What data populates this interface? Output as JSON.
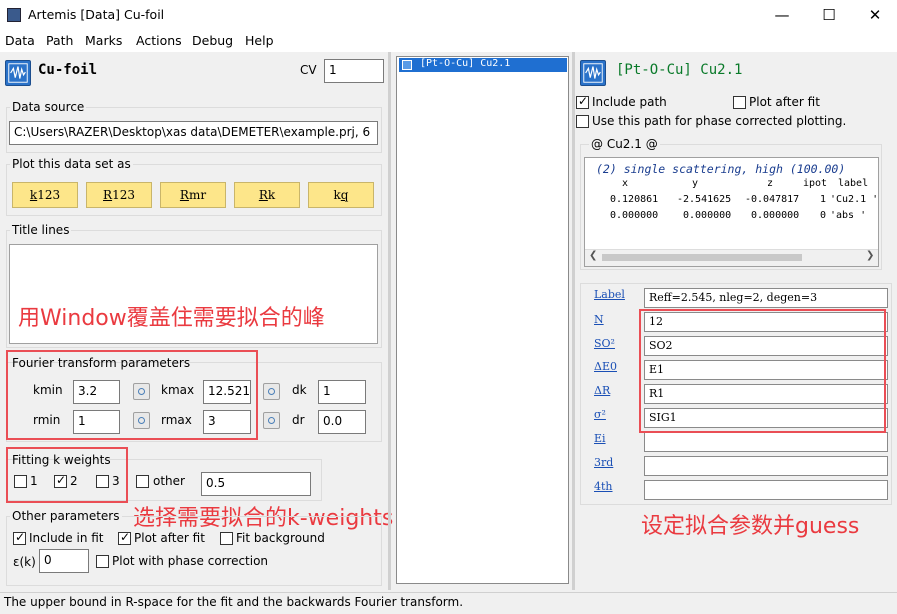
{
  "window": {
    "title": "Artemis [Data] Cu-foil",
    "minimize": "—",
    "maximize": "☐",
    "close": "✕"
  },
  "menu": [
    "Data",
    "Path",
    "Marks",
    "Actions",
    "Debug",
    "Help"
  ],
  "left": {
    "data_name": "Cu-foil",
    "cv_label": "CV",
    "cv_value": "1",
    "data_source_label": "Data source",
    "data_source_path": "C:\\Users\\RAZER\\Desktop\\xas data\\DEMETER\\example.prj, 6",
    "plot_label": "Plot this data set as",
    "plot_buttons": [
      {
        "prefix": "",
        "ul": "k",
        "rest": "123"
      },
      {
        "prefix": "",
        "ul": "R",
        "rest": "123"
      },
      {
        "prefix": "",
        "ul": "R",
        "rest": "mr"
      },
      {
        "prefix": "",
        "ul": "R",
        "rest": "k"
      },
      {
        "prefix": "k",
        "ul": "q",
        "rest": ""
      }
    ],
    "title_lines_label": "Title lines",
    "fourier_label": "Fourier transform parameters",
    "kmin_label": "kmin",
    "kmin_value": "3.2",
    "kmax_label": "kmax",
    "kmax_value": "12.521",
    "dk_label": "dk",
    "dk_value": "1",
    "rmin_label": "rmin",
    "rmin_value": "1",
    "rmax_label": "rmax",
    "rmax_value": "3",
    "dr_label": "dr",
    "dr_value": "0.0",
    "kweights_label": "Fitting k weights",
    "kw1": "1",
    "kw2": "2",
    "kw3": "3",
    "other_label": "other",
    "other_value": "0.5",
    "other_params_label": "Other parameters",
    "include_fit": "Include in fit",
    "plot_after_fit": "Plot after fit",
    "fit_background": "Fit background",
    "epsilon_label": "ε(k)",
    "epsilon_value": "0",
    "plot_phase": "Plot with phase correction"
  },
  "path_list": {
    "items": [
      "[Pt-O-Cu] Cu2.1"
    ]
  },
  "right": {
    "path_title": "[Pt-O-Cu] Cu2.1",
    "include_path": "Include path",
    "plot_after_fit": "Plot after fit",
    "use_phase": "Use this path for phase corrected plotting.",
    "feff_header": "@ Cu2.1  @",
    "feff_scattering": "(2) single scattering, high (100.00)",
    "feff_cols": {
      "x": "x",
      "y": "y",
      "z": "z",
      "ipot": "ipot",
      "label": "label"
    },
    "feff_rows": [
      {
        "x": "0.120861",
        "y": "-2.541625",
        "z": "-0.047817",
        "ipot": "1",
        "label": "'Cu2.1 '"
      },
      {
        "x": "0.000000",
        "y": "0.000000",
        "z": "0.000000",
        "ipot": "0",
        "label": "'abs '"
      }
    ],
    "params": [
      {
        "label": "Label",
        "value": "Reff=2.545, nleg=2, degen=3"
      },
      {
        "label": "N",
        "value": "12"
      },
      {
        "label": "SO²",
        "value": "SO2"
      },
      {
        "label": "ΔE0",
        "value": "E1"
      },
      {
        "label": "ΔR",
        "value": "R1"
      },
      {
        "label": "σ²",
        "value": "SIG1"
      },
      {
        "label": "Ei",
        "value": ""
      },
      {
        "label": "3rd",
        "value": ""
      },
      {
        "label": "4th",
        "value": ""
      }
    ]
  },
  "annotations": {
    "window_cover": "用Window覆盖住需要拟合的峰",
    "select_kweights": "选择需要拟合的k-weights",
    "set_params": "设定拟合参数并guess"
  },
  "status": "The upper bound in R-space for the fit and the backwards Fourier transform.",
  "colors": {
    "annotation_red": "#ea4e55",
    "plot_button_bg": "#fde68a",
    "title_green": "#0a7a2a",
    "feff_blue": "#1a3d8f"
  }
}
